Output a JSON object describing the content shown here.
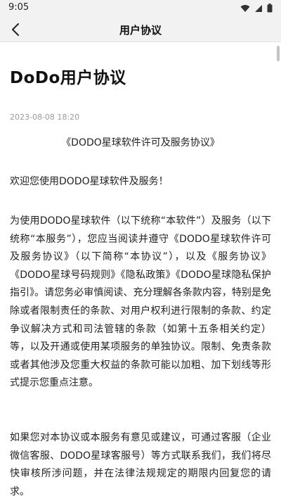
{
  "status": {
    "time": "9:05"
  },
  "nav": {
    "title": "用户协议"
  },
  "doc": {
    "title": "DoDo用户协议",
    "date": "2023-08-08 18:20",
    "heading": "《DODO星球软件许可及服务协议》",
    "paragraphs": [
      "欢迎您使用DODO星球软件及服务！",
      "为使用DODO星球软件（以下统称“本软件”）及服务（以下统称“本服务”），您应当阅读并遵守《DODO星球软件许可及服务协议》（以下简称“本协议”），以及《服务协议》《DODO星球号码规则》《隐私政策》《DODO星球隐私保护指引》。请您务必审慎阅读、充分理解各条款内容，特别是免除或者限制责任的条款、对用户权利进行限制的条款、约定争议解决方式和司法管辖的条款（如第十五条相关约定）等，以及开通或使用某项服务的单独协议。限制、免责条款或者其他涉及您重大权益的条款可能以加粗、加下划线等形式提示您重点注意。",
      "如果您对本协议或本服务有意见或建议，可通过客服（企业微信客服、DODO星球客服号）等方式联系我们，我们将尽快审核所涉问题，并在法律法规规定的期限内回复您的请求。"
    ]
  },
  "icons": {
    "back": "chevron-left-icon",
    "wifi": "wifi-icon",
    "signal": "signal-icon",
    "battery": "battery-icon"
  }
}
